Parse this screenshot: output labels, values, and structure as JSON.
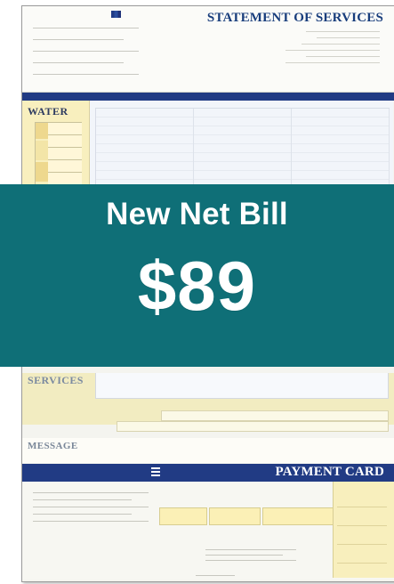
{
  "document": {
    "statement_title": "STATEMENT OF SERVICES",
    "section_water": "WATER",
    "section_services": "SERVICES",
    "section_message": "MESSAGE",
    "payment_title": "PAYMENT CARD"
  },
  "overlay": {
    "headline": "New Net Bill",
    "amount": "$89"
  },
  "colors": {
    "teal_band": "#0f6f77",
    "navy": "#213b84",
    "yellow_panel": "#f8efbe"
  },
  "icons": {
    "logo": "utility-logo-icon",
    "payment": "menu-lines-icon"
  }
}
